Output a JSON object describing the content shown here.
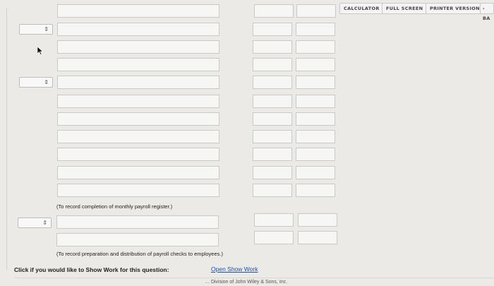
{
  "toolbar": {
    "calculator": "CALCULATOR",
    "full_screen": "FULL SCREEN",
    "printer_version": "PRINTER VERSION",
    "back": "‹ BA"
  },
  "entries": {
    "note_1": "(To record completion of monthly payroll register.)",
    "note_2": "(To record preparation and distribution of payroll checks to employees.)"
  },
  "show_work": {
    "label": "Click if you would like to Show Work for this question:",
    "link": "Open Show Work"
  },
  "footer": {
    "copyright": "… Division of John Wiley & Sons, Inc."
  },
  "icons": {
    "select_arrow": "updown-chevron-icon",
    "cursor": "mouse-pointer-icon"
  }
}
